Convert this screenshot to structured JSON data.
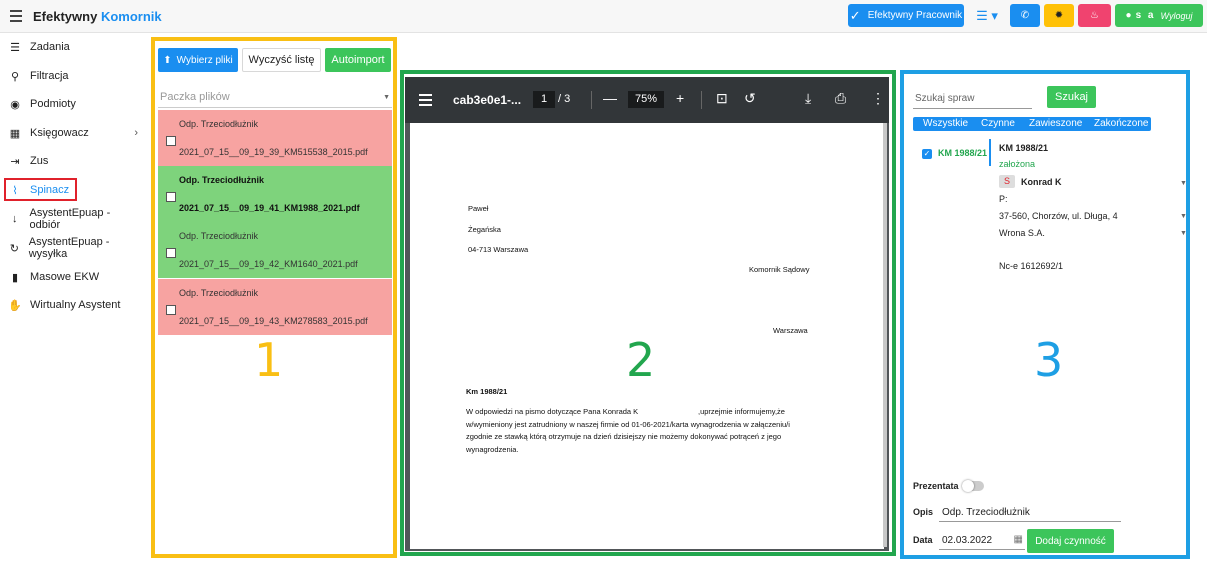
{
  "header": {
    "title_part1": "Efektywny",
    "title_part2": "Komornik",
    "pracownik_label": "Efektywny Pracownik",
    "menu_label": "☰ ▾",
    "user_initials": "s a",
    "logout_label": "Wyloguj"
  },
  "sidebar": {
    "items": [
      {
        "label": "Zadania",
        "icon": "list-icon"
      },
      {
        "label": "Filtracja",
        "icon": "search-icon"
      },
      {
        "label": "Podmioty",
        "icon": "globe-icon"
      },
      {
        "label": "Księgowacz",
        "icon": "calculator-icon"
      },
      {
        "label": "Zus",
        "icon": "import-icon"
      },
      {
        "label": "Spinacz",
        "icon": "paperclip-icon"
      },
      {
        "label": "AsystentEpuap - odbiór",
        "icon": "arrow-down-icon"
      },
      {
        "label": "AsystentEpuap - wysyłka",
        "icon": "redo-icon"
      },
      {
        "label": "Masowe EKW",
        "icon": "book-icon"
      },
      {
        "label": "Wirtualny Asystent",
        "icon": "handshake-icon"
      }
    ]
  },
  "panel1": {
    "wybierz_label": "Wybierz pliki",
    "wyczysc_label": "Wyczyść listę",
    "autoimport_label": "Autoimport",
    "paczka_placeholder": "Paczka plików",
    "files": [
      {
        "type": "Odp. Trzeciodłużnik",
        "name": "2021_07_15__09_19_39_KM515538_2015.pdf",
        "status": "red"
      },
      {
        "type": "Odp. Trzeciodłużnik",
        "name": "2021_07_15__09_19_41_KM1988_2021.pdf",
        "status": "green"
      },
      {
        "type": "Odp. Trzeciodłużnik",
        "name": "2021_07_15__09_19_42_KM1640_2021.pdf",
        "status": "green"
      },
      {
        "type": "Odp. Trzeciodłużnik",
        "name": "2021_07_15__09_19_43_KM278583_2015.pdf",
        "status": "red"
      }
    ],
    "label_number": "1"
  },
  "panel2": {
    "file_name": "cab3e0e1-...",
    "page_current": "1",
    "page_total": "/ 3",
    "zoom": "75%",
    "doc": {
      "line1": "Paweł",
      "line2": "Żegańska",
      "line3": "04-713 Warszawa",
      "line4": "Komornik Sądowy",
      "line5": "Warszawa",
      "line6": "Km 1988/21",
      "p1a": "W odpowiedzi na pismo dotyczące Pana Konrada K",
      "p1b": ",uprzejmie informujemy,że",
      "p2": "w/wymieniony jest zatrudniony w naszej firmie od 01-06-2021/karta wynagrodzenia w załączeniu/i",
      "p3": "zgodnie ze stawką którą otrzymuje na dzień dzisiejszy nie możemy dokonywać potrąceń z jego",
      "p4": "wynagrodzenia."
    },
    "label_number": "2"
  },
  "panel3": {
    "search_placeholder": "Szukaj spraw",
    "szukaj_label": "Szukaj",
    "filters": [
      "Wszystkie",
      "Czynne",
      "Zawieszone",
      "Zakończone"
    ],
    "case_id": "KM 1988/21",
    "case_title": "KM 1988/21",
    "case_status": "założona",
    "party_badge": "S",
    "party_name": "Konrad K",
    "party_p": "P:",
    "party_address": "37-560, Chorzów, ul. Długa, 4",
    "party_company": "Wrona S.A.",
    "case_ref": "Nc-e 1612692/1",
    "prezentata_label": "Prezentata",
    "opis_label": "Opis",
    "opis_value": "Odp. Trzeciodłużnik",
    "data_label": "Data",
    "data_value": "02.03.2022",
    "dodaj_label": "Dodaj czynność",
    "label_number": "3"
  },
  "colors": {
    "primary": "#1a8ef0",
    "success": "#3cc55b",
    "warning": "#ffc107",
    "danger": "#f0436f",
    "panel1_border": "#f9bf14",
    "panel2_border": "#22a64e",
    "panel3_border": "#1e9fe4",
    "file_red": "#f7a3a1",
    "file_green": "#7ed37c"
  }
}
